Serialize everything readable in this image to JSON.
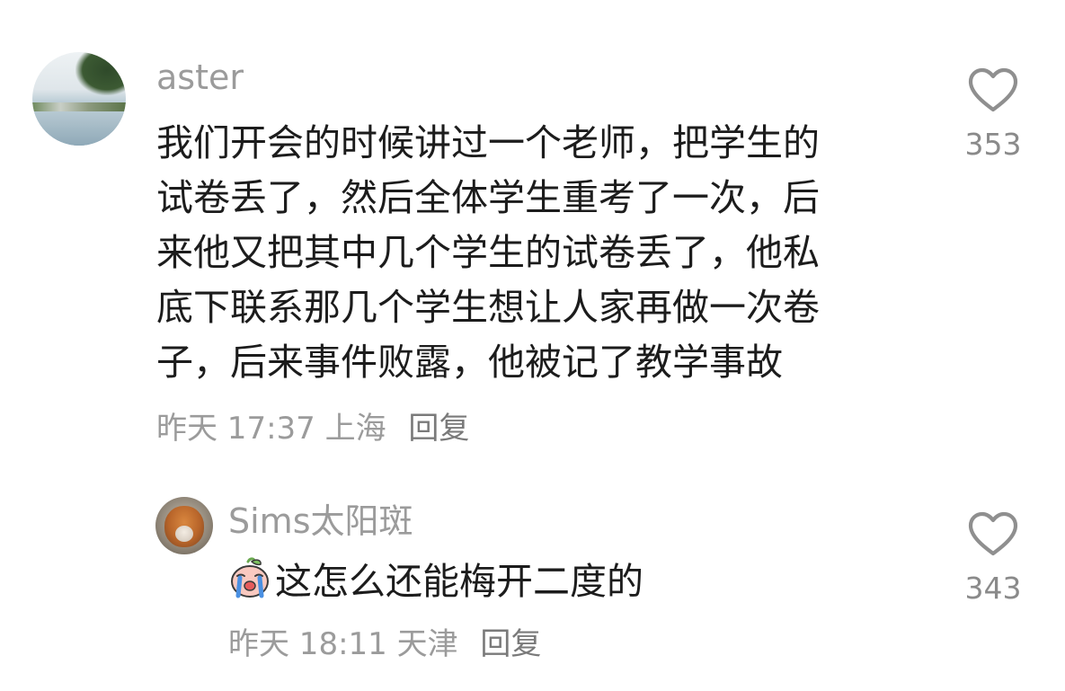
{
  "comments": [
    {
      "username": "aster",
      "lines": [
        "我们开会的时候讲过一个老师，把学生的",
        "试卷丢了，然后全体学生重考了一次，后",
        "来他又把其中几个学生的试卷丢了，他私",
        "底下联系那几个学生想让人家再做一次卷",
        "子，后来事件败露，他被记了教学事故"
      ],
      "time": "昨天 17:37",
      "location": "上海",
      "reply_label": "回复",
      "likes": "353",
      "like_icon": "heart-outline-icon"
    }
  ],
  "replies": [
    {
      "username": "Sims太阳斑",
      "emoji": "crying-peach-emoji",
      "text": "这怎么还能梅开二度的",
      "time": "昨天 18:11",
      "location": "天津",
      "reply_label": "回复",
      "likes": "343",
      "like_icon": "heart-outline-icon"
    }
  ]
}
